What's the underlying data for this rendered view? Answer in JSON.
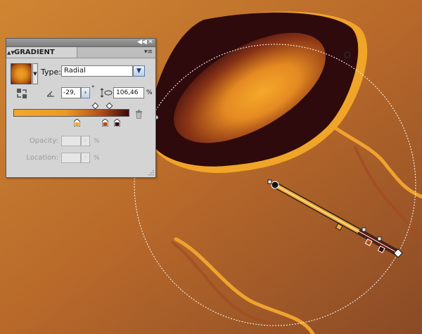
{
  "panel": {
    "title": "GRADIENT",
    "tab_arrows": "▲▼",
    "collapse_icon": "◀◀",
    "close_icon": "✕",
    "menu_icon": "▾≡",
    "type_label": "Type:",
    "type_value": "Radial",
    "angle_value": "-29,",
    "degree_symbol": "°",
    "aspect_value": "106,46",
    "aspect_unit": "%",
    "opacity_label": "Opacity:",
    "location_label": "Location:",
    "opacity_unit": "%",
    "location_unit": "%",
    "gradient_stops": [
      "#f6a82a",
      "#b34d18",
      "#3a0a0a"
    ],
    "dropdown_icon": "chevron-down-icon",
    "stepper_icon": "chevron-right-icon"
  },
  "colors": {
    "background_light": "#d08a32",
    "background_dark": "#8a4a26",
    "shape_dark": "#2e0a0c",
    "accent_orange": "#f2a528"
  }
}
